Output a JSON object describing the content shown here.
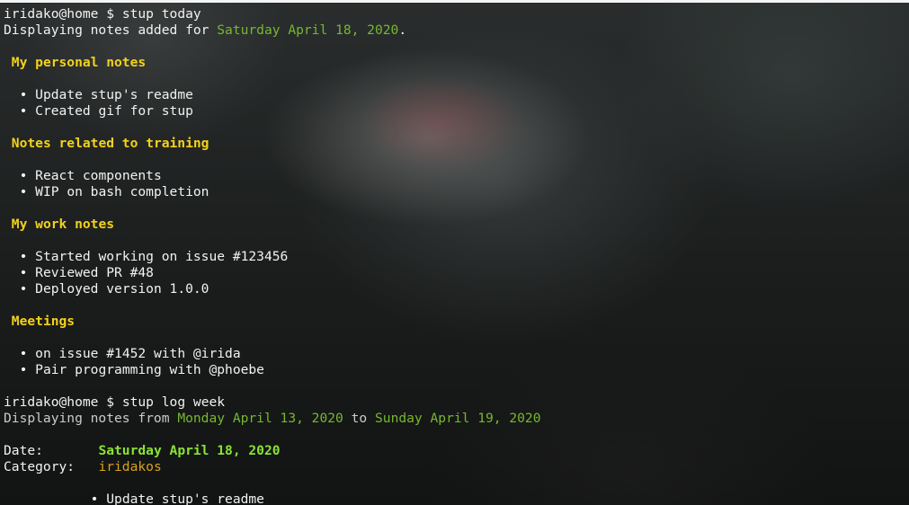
{
  "prompt1": {
    "user": "iridako@home",
    "symbol": "$",
    "command": "stup today"
  },
  "display1": {
    "prefix": "Displaying notes added for",
    "date": "Saturday April 18, 2020",
    "suffix": "."
  },
  "sections": [
    {
      "title": "My personal notes",
      "items": [
        "Update stup's readme",
        "Created gif for stup"
      ]
    },
    {
      "title": "Notes related to training",
      "items": [
        "React components",
        "WIP on bash completion"
      ]
    },
    {
      "title": "My work notes",
      "items": [
        "Started working on issue #123456",
        "Reviewed PR #48",
        "Deployed version 1.0.0"
      ]
    },
    {
      "title": "Meetings",
      "items": [
        "on issue #1452 with @irida",
        "Pair programming with @phoebe"
      ]
    }
  ],
  "prompt2": {
    "user": "iridako@home",
    "symbol": "$",
    "command": "stup log week"
  },
  "display2": {
    "prefix": "Displaying notes from",
    "from_date": "Monday April 13, 2020",
    "middle": "to",
    "to_date": "Sunday April 19, 2020"
  },
  "log_entry": {
    "date_label": "Date:",
    "date_value": "Saturday April 18, 2020",
    "category_label": "Category:",
    "category_value": "iridakos",
    "items": [
      "Update stup's readme"
    ]
  },
  "bullet": "•",
  "colors": {
    "heading": "#f2d21d",
    "date_green": "#76b830",
    "bold_green": "#8ae234",
    "category": "#d7a31b",
    "text": "#f2f2f2"
  }
}
